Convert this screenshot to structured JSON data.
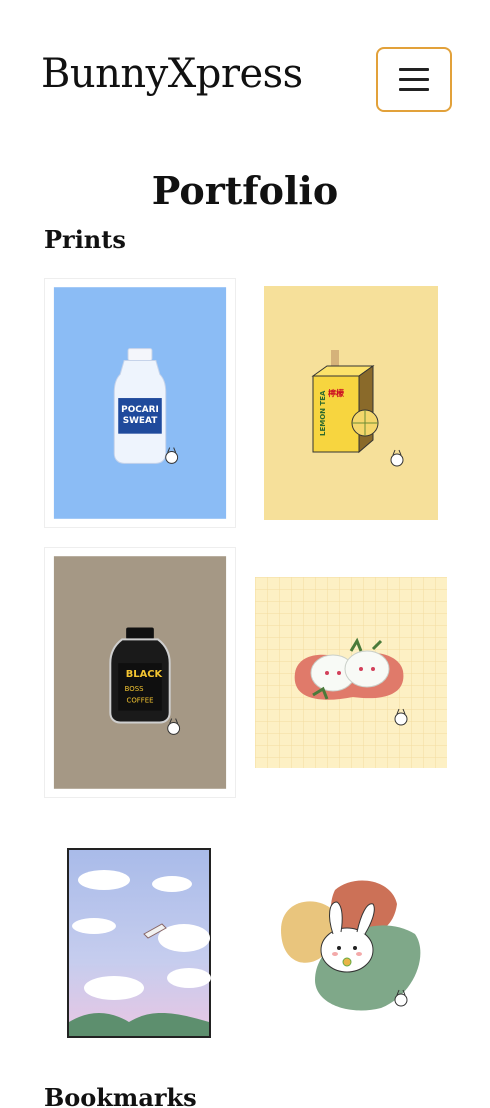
{
  "navbar": {
    "brand": "BunnyXpress",
    "toggler_icon": "hamburger-menu-icon",
    "toggler_border_color": "#e2a13a"
  },
  "main": {
    "title": "Portfolio",
    "sections": [
      {
        "title": "Prints",
        "items": [
          {
            "subject": "pocari-sweat-bottle",
            "background": "#8bbcf5",
            "label_lines": [
              "POCARI",
              "SWEAT"
            ]
          },
          {
            "subject": "lemon-tea-carton",
            "background": "#f6e09a",
            "label_lines": [
              "LEMON TEA",
              "檸檬"
            ]
          },
          {
            "subject": "boss-black-coffee-can",
            "background": "#a59885",
            "label_lines": [
              "BLACK",
              "BOSS",
              "COFFEE"
            ]
          },
          {
            "subject": "snow-bunny-mochi-strawberries",
            "background": "#fdf0c4"
          },
          {
            "subject": "sky-clouds-flying-cat",
            "background": "#b9c9ef"
          },
          {
            "subject": "bunny-with-flower",
            "background": "#ffffff"
          }
        ]
      },
      {
        "title": "Bookmarks"
      }
    ]
  }
}
